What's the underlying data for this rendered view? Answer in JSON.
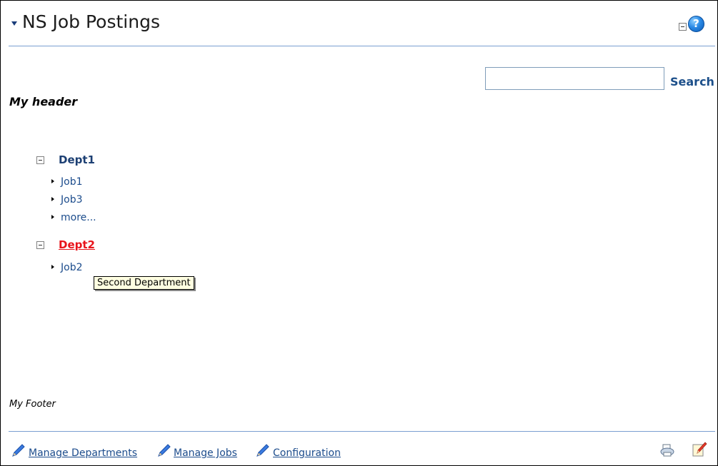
{
  "portlet": {
    "title": "NS Job Postings",
    "help_glyph": "?"
  },
  "search": {
    "value": "",
    "placeholder": "",
    "button_label": "Search"
  },
  "header_text": "My header",
  "departments": [
    {
      "name": "Dept1",
      "expanded": true,
      "jobs": [
        "Job1",
        "Job3"
      ],
      "more_label": "more..."
    },
    {
      "name": "Dept2",
      "expanded": true,
      "hovered": true,
      "jobs": [
        "Job2"
      ]
    }
  ],
  "tooltip": "Second Department",
  "footer_text": "My Footer",
  "footer_links": [
    "Manage Departments",
    "Manage Jobs",
    "Configuration"
  ],
  "icons": {
    "collapse": "collapse-triangle-icon",
    "minimize": "minimize-icon",
    "help": "help-icon",
    "tree_toggle": "tree-collapse-icon",
    "job_bullet": "bullet-triangle-icon",
    "link": "pencil-icon",
    "print": "print-icon",
    "edit": "edit-icon"
  },
  "colors": {
    "title_text": "#1c1c1c",
    "rule": "#7a9fd1",
    "link": "#1c4c8c",
    "dept_normal": "#1c3f73",
    "dept_hover": "#e8141b",
    "tooltip_bg": "#ffffe1"
  }
}
